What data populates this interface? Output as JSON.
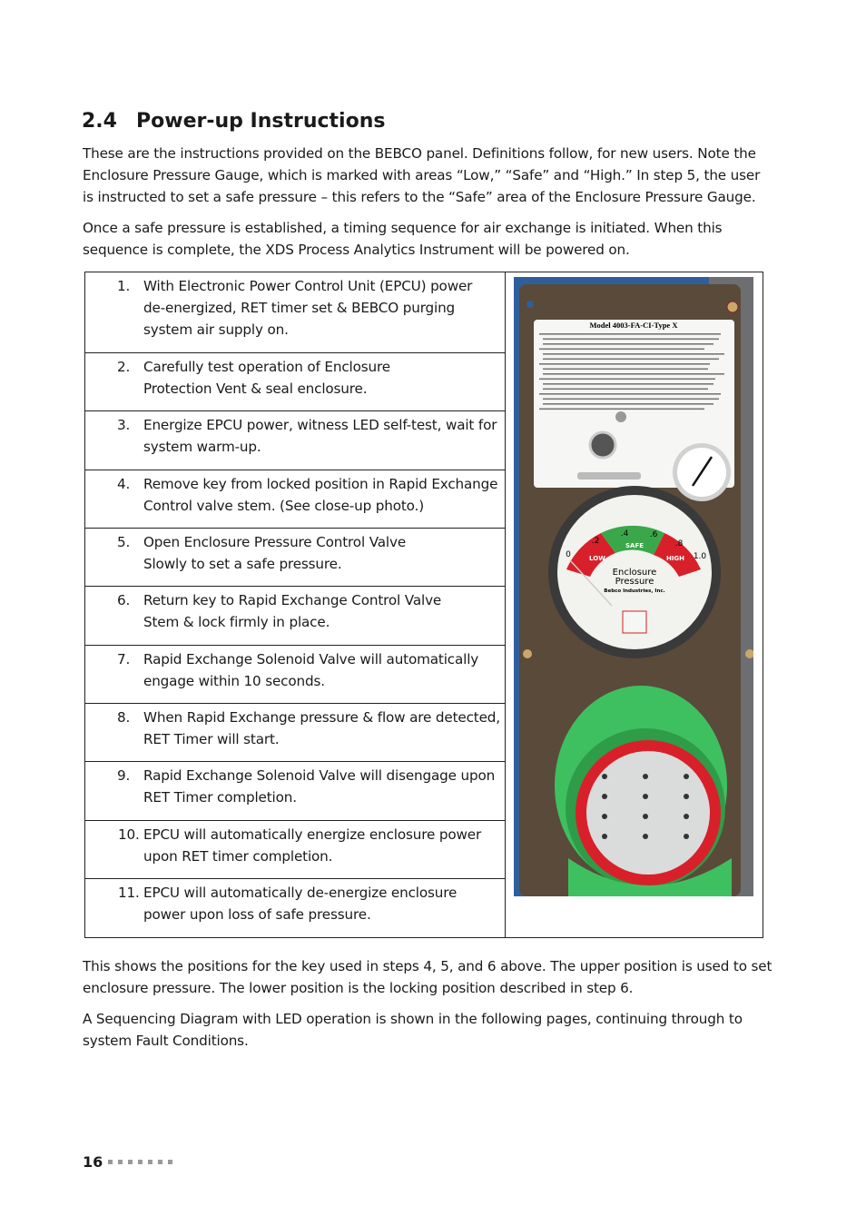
{
  "section": {
    "number": "2.4",
    "title": "Power-up Instructions"
  },
  "intro": {
    "paragraph1": [
      "These are the instructions provided on the BEBCO panel. Definitions follow, for new users. Note the",
      "Enclosure Pressure Gauge, which is marked with areas “Low,” “Safe” and “High.” In step 5, the user",
      "is instructed to set a safe pressure – this refers to the “Safe” area of the Enclosure Pressure Gauge."
    ],
    "paragraph2": [
      "Once a safe pressure is established, a timing sequence for air exchange is initiated. When this",
      "sequence is complete, the XDS Process Analytics Instrument will be powered on."
    ]
  },
  "steps": [
    {
      "num": "1.",
      "lines": [
        "With Electronic Power Control Unit (EPCU) power",
        "de-energized, RET timer set & BEBCO purging",
        "system air supply on."
      ]
    },
    {
      "num": "2.",
      "lines": [
        "Carefully test operation of Enclosure",
        "Protection Vent & seal enclosure."
      ]
    },
    {
      "num": "3.",
      "lines": [
        "Energize EPCU power, witness LED self-test, wait for",
        "system warm-up."
      ]
    },
    {
      "num": "4.",
      "lines": [
        "Remove key from locked position in Rapid Exchange",
        "Control valve stem. (See close-up photo.)"
      ]
    },
    {
      "num": "5.",
      "lines": [
        "Open Enclosure Pressure Control Valve",
        "Slowly to set a safe pressure."
      ]
    },
    {
      "num": "6.",
      "lines": [
        "Return key to Rapid Exchange Control Valve",
        "Stem & lock firmly in place."
      ]
    },
    {
      "num": "7.",
      "lines": [
        "Rapid Exchange Solenoid Valve will automatically",
        "engage within 10 seconds."
      ]
    },
    {
      "num": "8.",
      "lines": [
        "When Rapid Exchange pressure & flow are detected,",
        "RET Timer will start."
      ]
    },
    {
      "num": "9.",
      "lines": [
        "Rapid Exchange Solenoid Valve will disengage upon",
        "RET Timer completion."
      ]
    },
    {
      "num": "10.",
      "lines": [
        "EPCU will automatically energize enclosure power",
        "upon RET timer completion."
      ]
    },
    {
      "num": "11.",
      "lines": [
        "EPCU will automatically de-energize enclosure",
        "power upon loss of safe pressure."
      ]
    }
  ],
  "photo": {
    "label_model": "Model 4003-FA-CI-Type X",
    "gauge_ticks": [
      "0",
      ".2",
      ".4",
      ".6",
      ".8",
      "1.0"
    ],
    "gauge_zones": [
      "LOW",
      "SAFE",
      "HIGH"
    ],
    "gauge_title": [
      "Enclosure",
      "Pressure"
    ],
    "gauge_maker": "Bebco Industries, Inc.",
    "colors": {
      "background": "#2f5f9a",
      "panel": "#5a4a3a",
      "green_housing": "#3fc060",
      "safe": "#3aa84a",
      "low_high": "#d8202a"
    }
  },
  "outro": {
    "paragraph1": [
      "This shows the positions for the key used in steps 4, 5, and 6 above. The upper position is used to set",
      "enclosure pressure. The lower position is the locking position described in step 6."
    ],
    "paragraph2": [
      "A Sequencing Diagram with LED operation is shown in the following pages, continuing through to",
      "system Fault Conditions."
    ]
  },
  "footer": {
    "page_number": "16"
  }
}
